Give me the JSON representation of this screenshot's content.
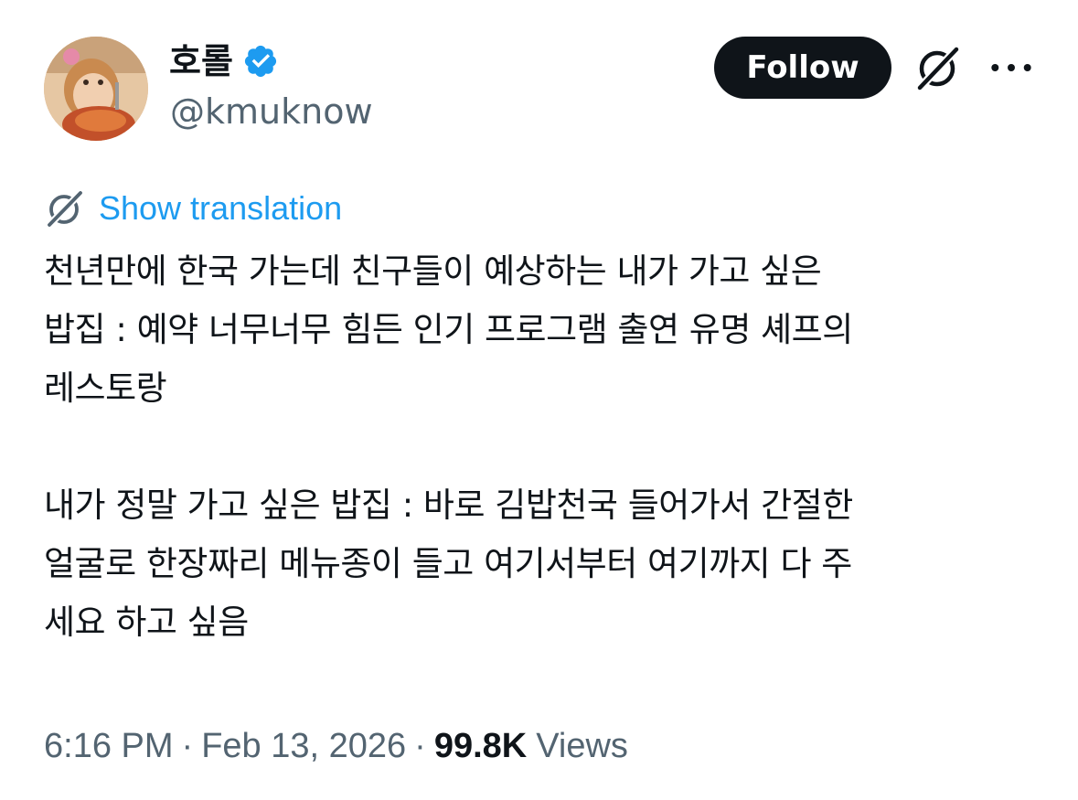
{
  "author": {
    "display_name": "호롤",
    "handle": "@kmuknow",
    "verified": true
  },
  "actions": {
    "follow_label": "Follow",
    "grok_icon": "grok-icon",
    "more_icon": "more-dots-icon"
  },
  "translation": {
    "icon": "grok-icon",
    "label": "Show translation"
  },
  "tweet": {
    "paragraph1": "천년만에 한국 가는데 친구들이 예상하는 내가 가고 싶은\n밥집 : 예약 너무너무 힘든 인기 프로그램 출연 유명 셰프의\n레스토랑",
    "paragraph2": "내가 정말 가고 싶은 밥집 : 바로 김밥천국 들어가서 간절한\n얼굴로 한장짜리 메뉴종이 들고 여기서부터 여기까지 다 주\n세요 하고 싶음"
  },
  "meta": {
    "time": "6:16 PM",
    "date": "Feb 13, 2026",
    "separator": "·",
    "views_count": "99.8K",
    "views_label": "Views"
  },
  "colors": {
    "text_primary": "#0f1419",
    "text_secondary": "#536471",
    "link": "#1d9bf0",
    "verified_badge": "#1d9bf0",
    "follow_bg": "#0f1419"
  }
}
